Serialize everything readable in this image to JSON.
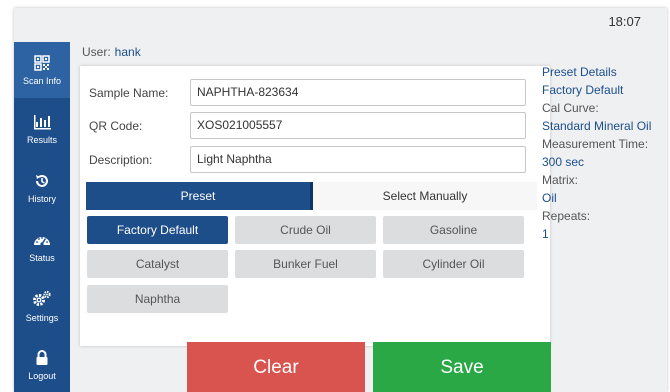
{
  "status_bar": {
    "time": "18:07"
  },
  "sidebar": {
    "items": [
      {
        "label": "Scan Info",
        "icon": "qr-icon",
        "active": true
      },
      {
        "label": "Results",
        "icon": "bar-chart-icon",
        "active": false
      },
      {
        "label": "History",
        "icon": "history-icon",
        "active": false
      },
      {
        "label": "Status",
        "icon": "gauge-icon",
        "active": false
      },
      {
        "label": "Settings",
        "icon": "gears-icon",
        "active": false
      },
      {
        "label": "Logout",
        "icon": "lock-icon",
        "active": false
      }
    ]
  },
  "user": {
    "label": "User:",
    "name": "hank"
  },
  "form": {
    "sample_name": {
      "label": "Sample Name:",
      "value": "NAPHTHA-823634"
    },
    "qr_code": {
      "label": "QR Code:",
      "value": "XOS021005557"
    },
    "description": {
      "label": "Description:",
      "value": "Light Naphtha"
    }
  },
  "mode_tabs": {
    "preset": "Preset",
    "manual": "Select Manually",
    "selected": "preset"
  },
  "presets": {
    "items": [
      "Factory Default",
      "Crude Oil",
      "Gasoline",
      "Catalyst",
      "Bunker Fuel",
      "Cylinder Oil",
      "Naphtha"
    ],
    "selected": "Factory Default"
  },
  "details": {
    "heading": "Preset Details",
    "preset_name": "Factory Default",
    "cal_curve_label": "Cal Curve:",
    "cal_curve_value": "Standard Mineral Oil",
    "measurement_time_label": "Measurement Time:",
    "measurement_time_value": "300 sec",
    "matrix_label": "Matrix:",
    "matrix_value": "Oil",
    "repeats_label": "Repeats:",
    "repeats_value": "1"
  },
  "actions": {
    "clear": "Clear",
    "save": "Save"
  },
  "colors": {
    "primary": "#1d4e8a",
    "sidebar_active": "#2d63a3",
    "clear": "#d9534f",
    "save": "#2aa845",
    "preset_inactive": "#dcdddf"
  }
}
